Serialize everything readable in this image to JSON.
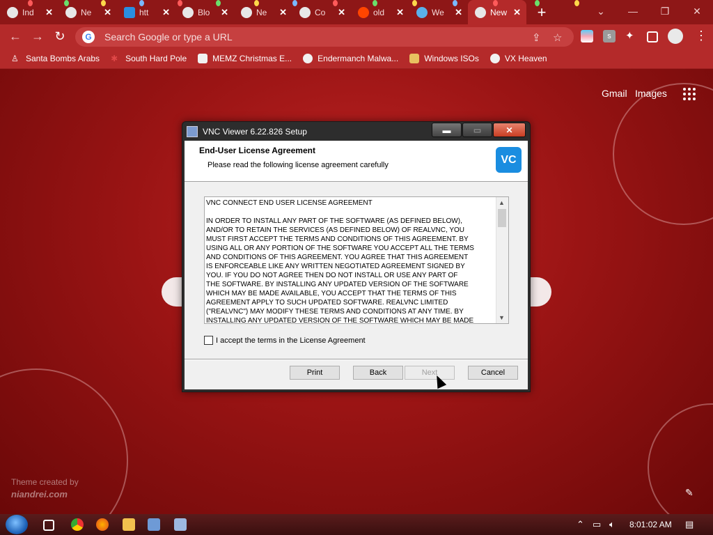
{
  "browser": {
    "tabs": [
      {
        "title": "Ind"
      },
      {
        "title": "Ne"
      },
      {
        "title": "htt"
      },
      {
        "title": "Blo"
      },
      {
        "title": "Ne"
      },
      {
        "title": "Co"
      },
      {
        "title": "old"
      },
      {
        "title": "We"
      },
      {
        "title": "New",
        "active": true
      }
    ],
    "new_tab_label": "+",
    "omnibox_placeholder": "Search Google or type a URL",
    "bookmarks": [
      {
        "label": "Santa Bombs Arabs"
      },
      {
        "label": "South Hard Pole"
      },
      {
        "label": "MEMZ Christmas E..."
      },
      {
        "label": "Endermanch Malwa..."
      },
      {
        "label": "Windows ISOs"
      },
      {
        "label": "VX Heaven"
      }
    ],
    "extension_badge": "s"
  },
  "ntp": {
    "gmail": "Gmail",
    "images": "Images",
    "theme_credit_line1": "Theme created by",
    "theme_credit_line2": "niandrei.com"
  },
  "dialog": {
    "window_title": "VNC Viewer 6.22.826 Setup",
    "header_title": "End-User License Agreement",
    "header_subtitle": "Please read the following license agreement carefully",
    "logo_text": "VC",
    "eula_text": "VNC CONNECT END USER LICENSE AGREEMENT\n\nIN ORDER TO INSTALL ANY PART OF THE SOFTWARE (AS DEFINED BELOW),\nAND/OR TO RETAIN THE SERVICES (AS DEFINED BELOW) OF REALVNC, YOU\nMUST FIRST ACCEPT THE TERMS AND CONDITIONS OF THIS AGREEMENT. BY\nUSING ALL OR ANY PORTION OF THE SOFTWARE YOU ACCEPT ALL THE TERMS\nAND CONDITIONS OF THIS AGREEMENT. YOU AGREE THAT THIS AGREEMENT\nIS ENFORCEABLE LIKE ANY WRITTEN NEGOTIATED AGREEMENT SIGNED BY\nYOU. IF YOU DO NOT AGREE THEN DO NOT INSTALL OR USE ANY PART OF\nTHE SOFTWARE. BY INSTALLING ANY UPDATED VERSION OF THE SOFTWARE\nWHICH MAY BE MADE AVAILABLE, YOU ACCEPT THAT THE TERMS OF THIS\nAGREEMENT APPLY TO SUCH UPDATED SOFTWARE. REALVNC LIMITED\n(\"REALVNC\") MAY MODIFY THESE TERMS AND CONDITIONS AT ANY TIME. BY\nINSTALLING ANY UPDATED VERSION OF THE SOFTWARE WHICH MAY BE MADE",
    "accept_label": "I accept the terms in the License Agreement",
    "accept_checked": false,
    "buttons": {
      "print": "Print",
      "back": "Back",
      "next": "Next",
      "cancel": "Cancel"
    },
    "next_enabled": false
  },
  "taskbar": {
    "clock": "8:01:02 AM"
  },
  "colors": {
    "chrome_frame": "#8e1717",
    "chrome_toolbar": "#b42a2a",
    "vnc_blue": "#1a8de0"
  }
}
